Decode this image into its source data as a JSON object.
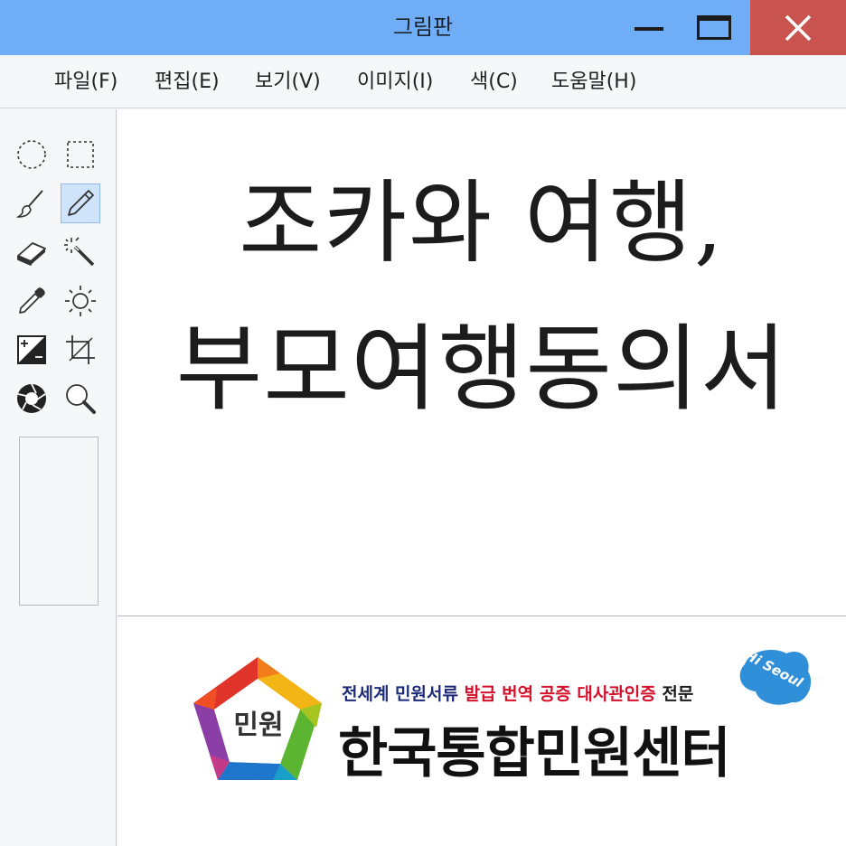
{
  "window": {
    "title": "그림판"
  },
  "menu": [
    {
      "label": "파일(F)"
    },
    {
      "label": "편집(E)"
    },
    {
      "label": "보기(V)"
    },
    {
      "label": "이미지(I)"
    },
    {
      "label": "색(C)"
    },
    {
      "label": "도움말(H)"
    }
  ],
  "tools": [
    {
      "icon": "ellipse-select-icon"
    },
    {
      "icon": "rect-select-icon"
    },
    {
      "icon": "brush-icon"
    },
    {
      "icon": "pencil-icon",
      "selected": true
    },
    {
      "icon": "eraser-icon"
    },
    {
      "icon": "magic-wand-icon"
    },
    {
      "icon": "eyedropper-icon"
    },
    {
      "icon": "brightness-icon"
    },
    {
      "icon": "contrast-icon"
    },
    {
      "icon": "crop-icon"
    },
    {
      "icon": "aperture-icon"
    },
    {
      "icon": "zoom-icon"
    }
  ],
  "canvas": {
    "headline_line1": "조카와 여행,",
    "headline_line2": "부모여행동의서",
    "logo": {
      "mark_text": "민원",
      "tagline_a": "전세계 민원서류",
      "tagline_b": "발급 번역 공증 대사관인증",
      "tagline_c": "전문",
      "org_name": "한국통합민원센터",
      "badge_text": "Hi Seoul"
    }
  },
  "colors": {
    "titlebar": "#6fadf7",
    "close_button": "#c9534f",
    "selected_tool": "#cfe4fb",
    "tagline_navy": "#1d2a7a",
    "tagline_red": "#d4102a",
    "badge_blue": "#2f8fd8"
  }
}
